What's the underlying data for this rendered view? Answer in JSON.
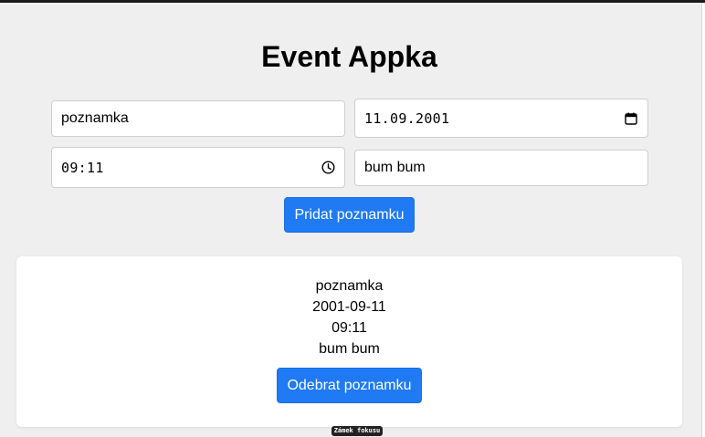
{
  "app": {
    "title": "Event Appka"
  },
  "form": {
    "name_value": "poznamka",
    "date_value": "11.09.2001",
    "time_value": "09:11",
    "desc_value": "bum bum",
    "add_button_label": "Pridat poznamku"
  },
  "notes": [
    {
      "name": "poznamka",
      "date": "2001-09-11",
      "time": "09:11",
      "desc": "bum bum",
      "remove_button_label": "Odebrat poznamku"
    }
  ],
  "focus_lock_label": "Zámek fokusu",
  "icons": {
    "date": "calendar-icon",
    "time": "clock-icon"
  },
  "colors": {
    "accent": "#1f7af3",
    "background": "#efefef"
  }
}
